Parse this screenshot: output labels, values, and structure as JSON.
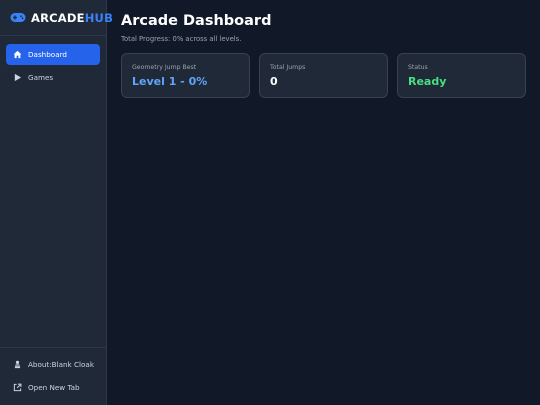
{
  "brand": {
    "name_part1": "ARCADE",
    "name_part2": "HUB",
    "icon": "gamepad-icon"
  },
  "nav": [
    {
      "label": "Dashboard",
      "icon": "home-icon",
      "active": true
    },
    {
      "label": "Games",
      "icon": "play-icon",
      "active": false
    }
  ],
  "footer": [
    {
      "label": "About:Blank Cloak",
      "icon": "cloak-icon"
    },
    {
      "label": "Open New Tab",
      "icon": "external-link-icon"
    }
  ],
  "main": {
    "title": "Arcade Dashboard",
    "subtitle": "Total Progress: 0% across all levels."
  },
  "cards": [
    {
      "label": "Geometry Jump Best",
      "value": "Level 1 - 0%"
    },
    {
      "label": "Total Jumps",
      "value": "0"
    },
    {
      "label": "Status",
      "value": "Ready"
    }
  ],
  "colors": {
    "background": "#111827",
    "sidebar": "#1f2937",
    "accent": "#2563eb",
    "brand_hub": "#3b82f6",
    "value_blue": "#60a5fa",
    "value_green": "#4ade80"
  }
}
